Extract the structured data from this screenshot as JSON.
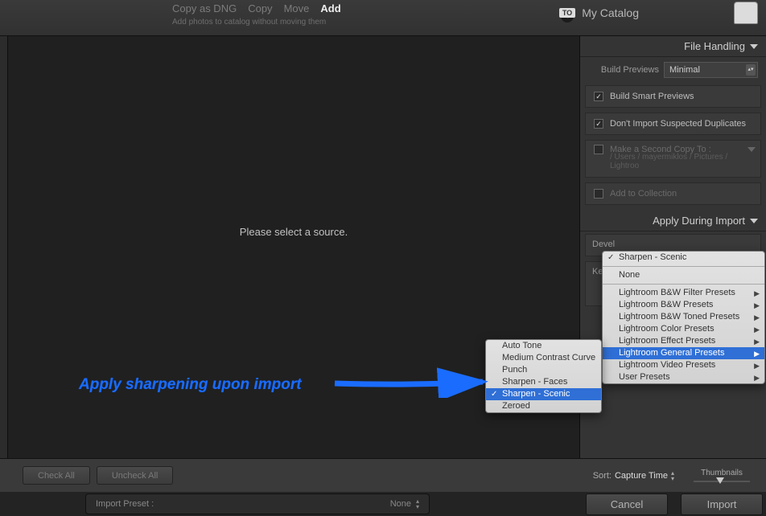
{
  "topbar": {
    "modes": [
      "Copy as DNG",
      "Copy",
      "Move",
      "Add"
    ],
    "active_mode": "Add",
    "subtitle": "Add photos to catalog without moving them",
    "to_label": "TO",
    "catalog": "My Catalog"
  },
  "center": {
    "message": "Please select a source."
  },
  "file_handling": {
    "title": "File Handling",
    "build_previews_label": "Build Previews",
    "build_previews_value": "Minimal",
    "smart_previews": "Build Smart Previews",
    "no_duplicates": "Don't Import Suspected Duplicates",
    "second_copy_label": "Make a Second Copy To :",
    "second_copy_path": "/ Users / mayermiklos / Pictures / Lightroo",
    "add_to_collection": "Add to Collection"
  },
  "apply_during_import": {
    "title": "Apply During Import",
    "develop_label": "Devel",
    "keywords_label": "Keywor"
  },
  "submenu": {
    "items": [
      "Auto Tone",
      "Medium Contrast Curve",
      "Punch",
      "Sharpen - Faces",
      "Sharpen - Scenic",
      "Zeroed"
    ],
    "highlighted": "Sharpen - Scenic"
  },
  "main_menu": {
    "current": "Sharpen - Scenic",
    "none": "None",
    "groups": [
      "Lightroom B&W Filter Presets",
      "Lightroom B&W Presets",
      "Lightroom B&W Toned Presets",
      "Lightroom Color Presets",
      "Lightroom Effect Presets",
      "Lightroom General Presets",
      "Lightroom Video Presets",
      "User Presets"
    ],
    "highlighted": "Lightroom General Presets"
  },
  "bottom": {
    "check_all": "Check All",
    "uncheck_all": "Uncheck All",
    "sort_label": "Sort:",
    "sort_value": "Capture Time",
    "thumbnails_label": "Thumbnails"
  },
  "footer": {
    "import_preset_label": "Import Preset :",
    "import_preset_value": "None",
    "cancel": "Cancel",
    "import": "Import"
  },
  "annotation": {
    "text": "Apply sharpening upon import"
  }
}
